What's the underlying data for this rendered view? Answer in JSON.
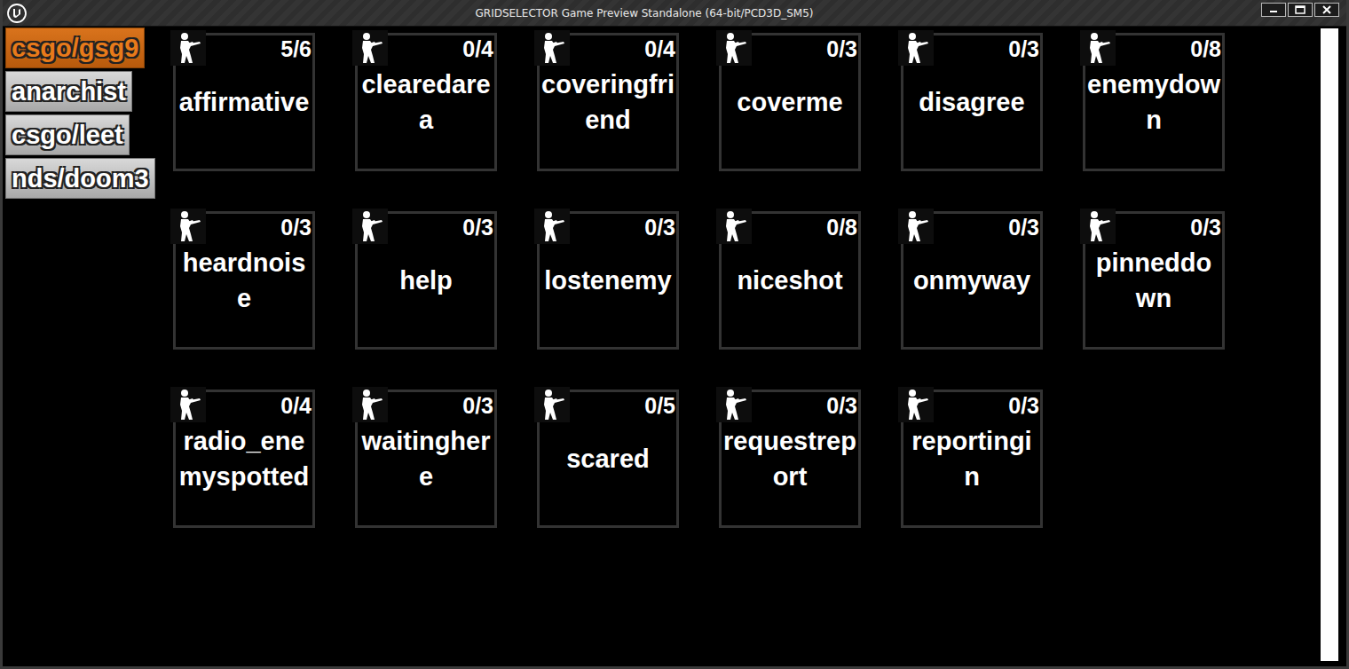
{
  "window": {
    "title": "GRIDSELECTOR Game Preview Standalone (64-bit/PCD3D_SM5)"
  },
  "categories": [
    {
      "label": "csgo/gsg9",
      "selected": true
    },
    {
      "label": "anarchist",
      "selected": false
    },
    {
      "label": "csgo/leet",
      "selected": false
    },
    {
      "label": "nds/doom3",
      "selected": false
    }
  ],
  "cards": [
    {
      "label": "affirmative",
      "count": "5/6"
    },
    {
      "label": "clearedarea",
      "count": "0/4"
    },
    {
      "label": "coveringfriend",
      "count": "0/4"
    },
    {
      "label": "coverme",
      "count": "0/3"
    },
    {
      "label": "disagree",
      "count": "0/3"
    },
    {
      "label": "enemydown",
      "count": "0/8"
    },
    {
      "label": "heardnoise",
      "count": "0/3"
    },
    {
      "label": "help",
      "count": "0/3"
    },
    {
      "label": "lostenemy",
      "count": "0/3"
    },
    {
      "label": "niceshot",
      "count": "0/8"
    },
    {
      "label": "onmyway",
      "count": "0/3"
    },
    {
      "label": "pinneddown",
      "count": "0/3"
    },
    {
      "label": "radio_enemyspotted",
      "count": "0/4"
    },
    {
      "label": "waitinghere",
      "count": "0/3"
    },
    {
      "label": "scared",
      "count": "0/5"
    },
    {
      "label": "requestreport",
      "count": "0/3"
    },
    {
      "label": "reportingin",
      "count": "0/3"
    }
  ]
}
